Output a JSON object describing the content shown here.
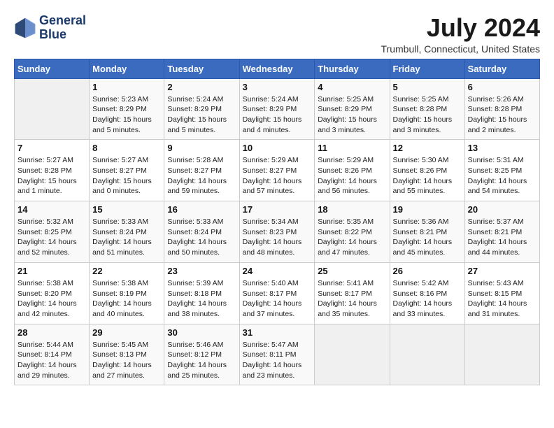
{
  "logo": {
    "line1": "General",
    "line2": "Blue"
  },
  "title": {
    "month_year": "July 2024",
    "location": "Trumbull, Connecticut, United States"
  },
  "headers": [
    "Sunday",
    "Monday",
    "Tuesday",
    "Wednesday",
    "Thursday",
    "Friday",
    "Saturday"
  ],
  "weeks": [
    [
      {
        "day": "",
        "info": ""
      },
      {
        "day": "1",
        "info": "Sunrise: 5:23 AM\nSunset: 8:29 PM\nDaylight: 15 hours\nand 5 minutes."
      },
      {
        "day": "2",
        "info": "Sunrise: 5:24 AM\nSunset: 8:29 PM\nDaylight: 15 hours\nand 5 minutes."
      },
      {
        "day": "3",
        "info": "Sunrise: 5:24 AM\nSunset: 8:29 PM\nDaylight: 15 hours\nand 4 minutes."
      },
      {
        "day": "4",
        "info": "Sunrise: 5:25 AM\nSunset: 8:29 PM\nDaylight: 15 hours\nand 3 minutes."
      },
      {
        "day": "5",
        "info": "Sunrise: 5:25 AM\nSunset: 8:28 PM\nDaylight: 15 hours\nand 3 minutes."
      },
      {
        "day": "6",
        "info": "Sunrise: 5:26 AM\nSunset: 8:28 PM\nDaylight: 15 hours\nand 2 minutes."
      }
    ],
    [
      {
        "day": "7",
        "info": "Sunrise: 5:27 AM\nSunset: 8:28 PM\nDaylight: 15 hours\nand 1 minute."
      },
      {
        "day": "8",
        "info": "Sunrise: 5:27 AM\nSunset: 8:27 PM\nDaylight: 15 hours\nand 0 minutes."
      },
      {
        "day": "9",
        "info": "Sunrise: 5:28 AM\nSunset: 8:27 PM\nDaylight: 14 hours\nand 59 minutes."
      },
      {
        "day": "10",
        "info": "Sunrise: 5:29 AM\nSunset: 8:27 PM\nDaylight: 14 hours\nand 57 minutes."
      },
      {
        "day": "11",
        "info": "Sunrise: 5:29 AM\nSunset: 8:26 PM\nDaylight: 14 hours\nand 56 minutes."
      },
      {
        "day": "12",
        "info": "Sunrise: 5:30 AM\nSunset: 8:26 PM\nDaylight: 14 hours\nand 55 minutes."
      },
      {
        "day": "13",
        "info": "Sunrise: 5:31 AM\nSunset: 8:25 PM\nDaylight: 14 hours\nand 54 minutes."
      }
    ],
    [
      {
        "day": "14",
        "info": "Sunrise: 5:32 AM\nSunset: 8:25 PM\nDaylight: 14 hours\nand 52 minutes."
      },
      {
        "day": "15",
        "info": "Sunrise: 5:33 AM\nSunset: 8:24 PM\nDaylight: 14 hours\nand 51 minutes."
      },
      {
        "day": "16",
        "info": "Sunrise: 5:33 AM\nSunset: 8:24 PM\nDaylight: 14 hours\nand 50 minutes."
      },
      {
        "day": "17",
        "info": "Sunrise: 5:34 AM\nSunset: 8:23 PM\nDaylight: 14 hours\nand 48 minutes."
      },
      {
        "day": "18",
        "info": "Sunrise: 5:35 AM\nSunset: 8:22 PM\nDaylight: 14 hours\nand 47 minutes."
      },
      {
        "day": "19",
        "info": "Sunrise: 5:36 AM\nSunset: 8:21 PM\nDaylight: 14 hours\nand 45 minutes."
      },
      {
        "day": "20",
        "info": "Sunrise: 5:37 AM\nSunset: 8:21 PM\nDaylight: 14 hours\nand 44 minutes."
      }
    ],
    [
      {
        "day": "21",
        "info": "Sunrise: 5:38 AM\nSunset: 8:20 PM\nDaylight: 14 hours\nand 42 minutes."
      },
      {
        "day": "22",
        "info": "Sunrise: 5:38 AM\nSunset: 8:19 PM\nDaylight: 14 hours\nand 40 minutes."
      },
      {
        "day": "23",
        "info": "Sunrise: 5:39 AM\nSunset: 8:18 PM\nDaylight: 14 hours\nand 38 minutes."
      },
      {
        "day": "24",
        "info": "Sunrise: 5:40 AM\nSunset: 8:17 PM\nDaylight: 14 hours\nand 37 minutes."
      },
      {
        "day": "25",
        "info": "Sunrise: 5:41 AM\nSunset: 8:17 PM\nDaylight: 14 hours\nand 35 minutes."
      },
      {
        "day": "26",
        "info": "Sunrise: 5:42 AM\nSunset: 8:16 PM\nDaylight: 14 hours\nand 33 minutes."
      },
      {
        "day": "27",
        "info": "Sunrise: 5:43 AM\nSunset: 8:15 PM\nDaylight: 14 hours\nand 31 minutes."
      }
    ],
    [
      {
        "day": "28",
        "info": "Sunrise: 5:44 AM\nSunset: 8:14 PM\nDaylight: 14 hours\nand 29 minutes."
      },
      {
        "day": "29",
        "info": "Sunrise: 5:45 AM\nSunset: 8:13 PM\nDaylight: 14 hours\nand 27 minutes."
      },
      {
        "day": "30",
        "info": "Sunrise: 5:46 AM\nSunset: 8:12 PM\nDaylight: 14 hours\nand 25 minutes."
      },
      {
        "day": "31",
        "info": "Sunrise: 5:47 AM\nSunset: 8:11 PM\nDaylight: 14 hours\nand 23 minutes."
      },
      {
        "day": "",
        "info": ""
      },
      {
        "day": "",
        "info": ""
      },
      {
        "day": "",
        "info": ""
      }
    ]
  ]
}
